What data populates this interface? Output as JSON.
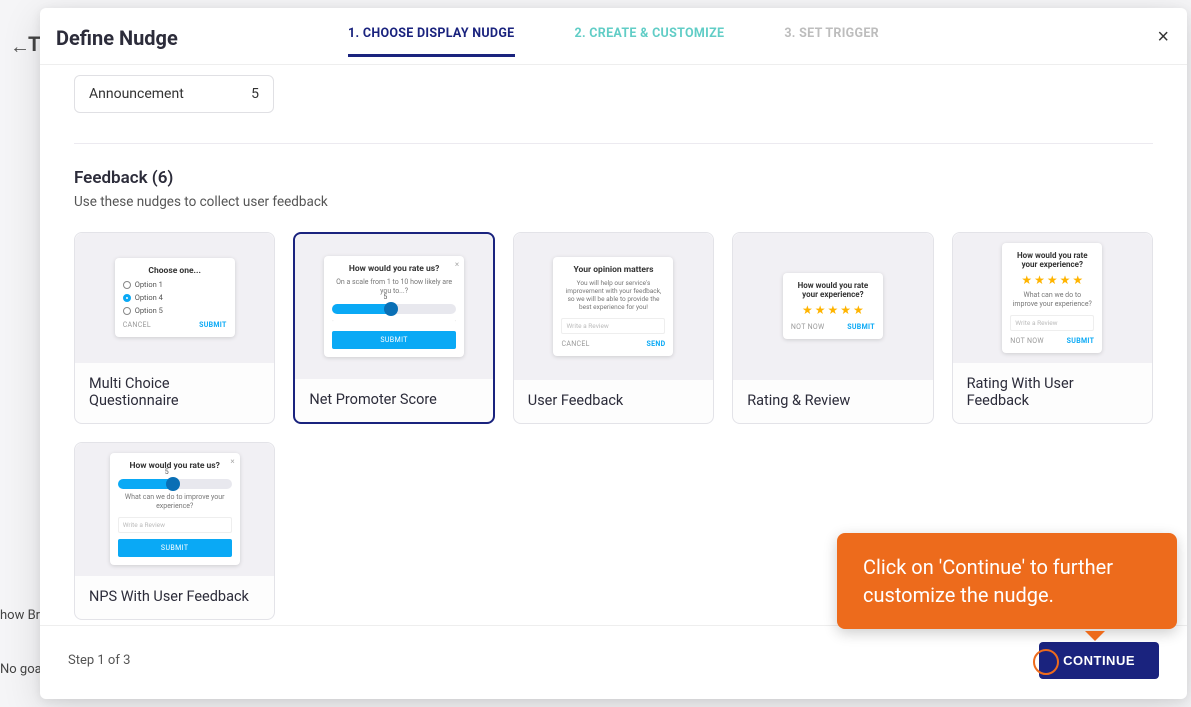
{
  "background": {
    "back_arrow": "←",
    "hidden_title_prefix": "T",
    "left_label_1": "how Bra",
    "left_label_2": "No goal"
  },
  "modal": {
    "title": "Define Nudge",
    "close_label": "×",
    "steps": [
      {
        "label": "1. CHOOSE DISPLAY NUDGE",
        "state": "active"
      },
      {
        "label": "2. CREATE & CUSTOMIZE",
        "state": "muted"
      },
      {
        "label": "3. SET TRIGGER",
        "state": "default"
      }
    ],
    "prev_section_item": {
      "title": "Announcement",
      "count": "5"
    },
    "feedback": {
      "title": "Feedback (6)",
      "subtitle": "Use these nudges to collect user feedback",
      "cards": [
        {
          "id": "multi-choice",
          "label": "Multi Choice Questionnaire",
          "selected": false
        },
        {
          "id": "nps",
          "label": "Net Promoter Score",
          "selected": true
        },
        {
          "id": "user-feedback",
          "label": "User Feedback",
          "selected": false
        },
        {
          "id": "rating-review",
          "label": "Rating & Review",
          "selected": false
        },
        {
          "id": "rating-feedback",
          "label": "Rating With User Feedback",
          "selected": false
        },
        {
          "id": "nps-feedback",
          "label": "NPS With User Feedback",
          "selected": false
        }
      ]
    },
    "footer": {
      "step_text": "Step 1 of 3",
      "continue_label": "CONTINUE"
    },
    "preview_text": {
      "mc_title": "Choose one...",
      "mc_opt1": "Option 1",
      "mc_opt4": "Option 4",
      "mc_opt5": "Option 5",
      "cancel": "CANCEL",
      "submit": "SUBMIT",
      "send": "SEND",
      "not_now": "NOT NOW",
      "nps_title": "How would you rate us?",
      "nps_sub": "On a scale from 1 to 10 how likely are you to...?",
      "uf_title": "Your opinion matters",
      "uf_sub": "You will help our service's improvement with your feedback, so we will be able to provide the best experience for you!",
      "uf_input": "Write a Review",
      "rr_title": "How would you rate your experience?",
      "rwf_title": "How would you rate your experience?",
      "rwf_sub": "What can we do to improve your experience?",
      "npsf_title": "How would you rate us?",
      "npsf_sub": "What can we do to improve your experience?",
      "slider_num": "5"
    }
  },
  "tooltip": {
    "text": "Click on 'Continue' to further customize the nudge."
  }
}
